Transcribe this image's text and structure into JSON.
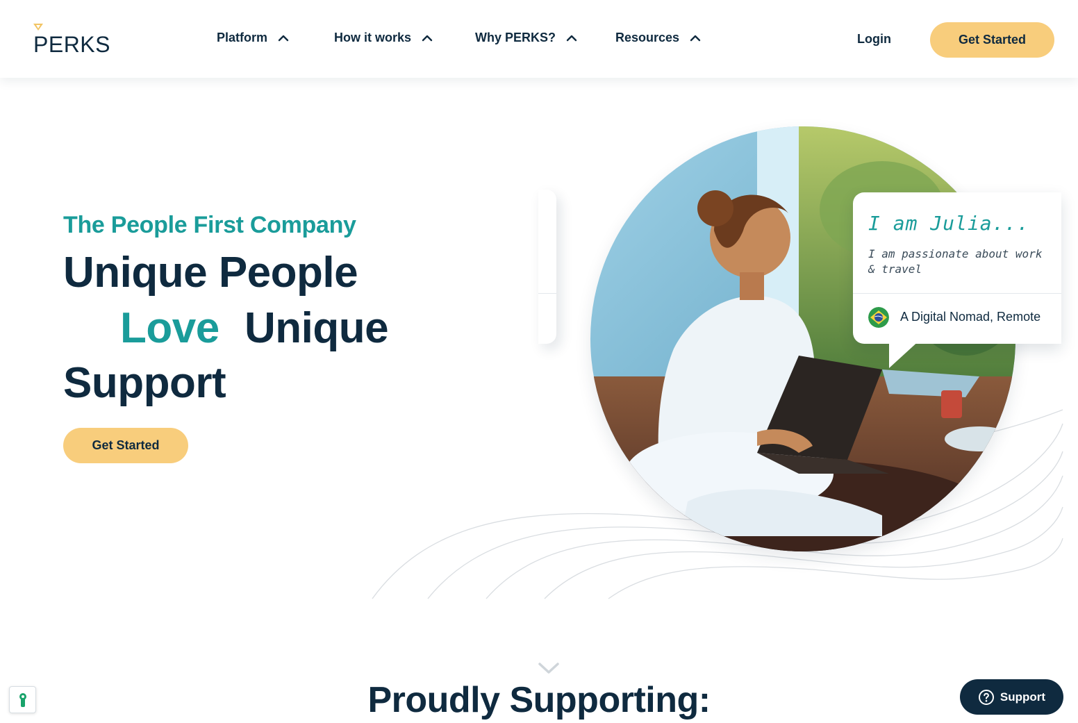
{
  "brand": {
    "name": "PERKS"
  },
  "nav": {
    "items": [
      {
        "label": "Platform"
      },
      {
        "label": "How it works"
      },
      {
        "label": "Why PERKS?"
      },
      {
        "label": "Resources"
      }
    ],
    "login_label": "Login",
    "cta_label": "Get Started"
  },
  "hero": {
    "eyebrow": "The People First Company",
    "line1": "Unique People",
    "line2_word1": "Love",
    "line2_word2": "Unique",
    "line3": "Support",
    "cta_label": "Get Started"
  },
  "profile_card": {
    "name": "I am Julia...",
    "description": "I am passionate about work & travel",
    "location": "A Digital Nomad, Remote",
    "flag_icon": "brazil-flag-icon"
  },
  "section": {
    "title": "Proudly Supporting:"
  },
  "support_button": {
    "label": "Support",
    "icon": "help-circle-icon"
  },
  "cookie_button": {
    "icon": "cookie-preferences-icon"
  },
  "colors": {
    "navy": "#0f2a3f",
    "teal": "#1a9c9a",
    "accent_yellow": "#f8cd7c",
    "logo_mark": "#f2c463"
  }
}
